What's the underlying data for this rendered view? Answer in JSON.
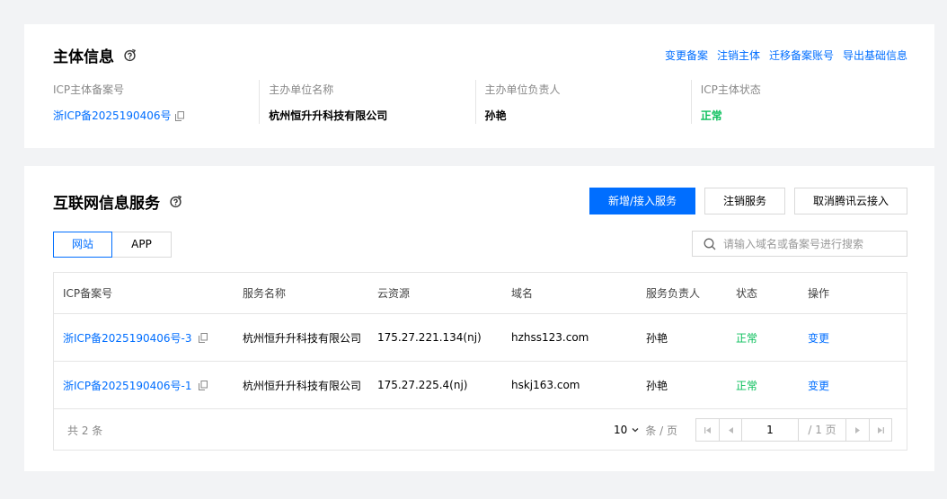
{
  "subject": {
    "title": "主体信息",
    "actions": [
      "变更备案",
      "注销主体",
      "迁移备案账号",
      "导出基础信息"
    ],
    "fields": [
      {
        "label": "ICP主体备案号",
        "value": "浙ICP备2025190406号"
      },
      {
        "label": "主办单位名称",
        "value": "杭州恒升升科技有限公司"
      },
      {
        "label": "主办单位负责人",
        "value": "孙艳"
      },
      {
        "label": "ICP主体状态",
        "value": "正常"
      }
    ]
  },
  "services": {
    "title": "互联网信息服务",
    "buttons": {
      "add": "新增/接入服务",
      "cancel": "注销服务",
      "cancel_access": "取消腾讯云接入"
    },
    "tabs": [
      "网站",
      "APP"
    ],
    "search_placeholder": "请输入域名或备案号进行搜索",
    "columns": [
      "ICP备案号",
      "服务名称",
      "云资源",
      "域名",
      "服务负责人",
      "状态",
      "操作"
    ],
    "rows": [
      {
        "icp": "浙ICP备2025190406号-3",
        "name": "杭州恒升升科技有限公司",
        "resource": "175.27.221.134(nj)",
        "domain": "hzhss123.com",
        "owner": "孙艳",
        "status": "正常",
        "action": "变更"
      },
      {
        "icp": "浙ICP备2025190406号-1",
        "name": "杭州恒升升科技有限公司",
        "resource": "175.27.225.4(nj)",
        "domain": "hskj163.com",
        "owner": "孙艳",
        "status": "正常",
        "action": "变更"
      }
    ],
    "footer": {
      "total": "共 2 条",
      "page_size": "10",
      "per_page_label": "条 / 页",
      "page": "1",
      "total_pages": "/ 1 页"
    }
  },
  "colors": {
    "accent": "#006eff",
    "ok": "#0abf5b"
  }
}
